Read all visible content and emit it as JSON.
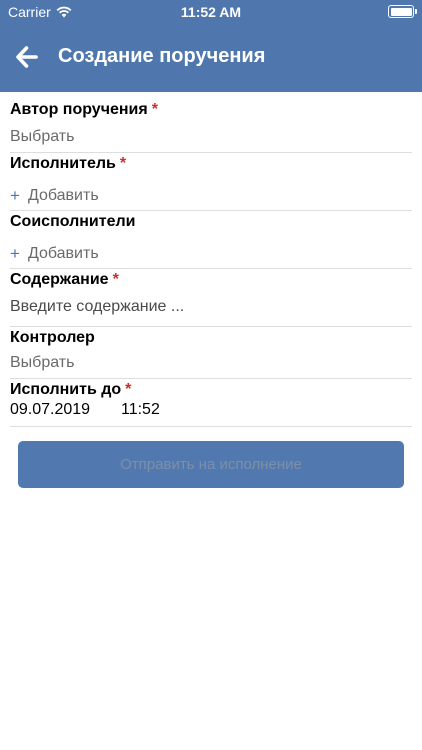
{
  "status_bar": {
    "carrier": "Carrier",
    "time": "11:52 AM"
  },
  "header": {
    "title": "Создание поручения"
  },
  "form": {
    "author": {
      "label": "Автор поручения",
      "required_mark": "*",
      "value": "Выбрать"
    },
    "executor": {
      "label": "Исполнитель",
      "required_mark": "*",
      "add_label": "Добавить",
      "add_symbol": "+"
    },
    "coexecutors": {
      "label": "Соисполнители",
      "add_label": "Добавить",
      "add_symbol": "+"
    },
    "content": {
      "label": "Содержание",
      "required_mark": "*",
      "placeholder": "Введите содержание ..."
    },
    "controller": {
      "label": "Контролер",
      "value": "Выбрать"
    },
    "deadline": {
      "label": "Исполнить до",
      "required_mark": "*",
      "date": "09.07.2019",
      "time": "11:52"
    }
  },
  "submit": {
    "label": "Отправить на исполнение"
  },
  "colors": {
    "header_bg": "#4f77ad",
    "required": "#d12b2b",
    "button_bg": "#5179b0"
  }
}
